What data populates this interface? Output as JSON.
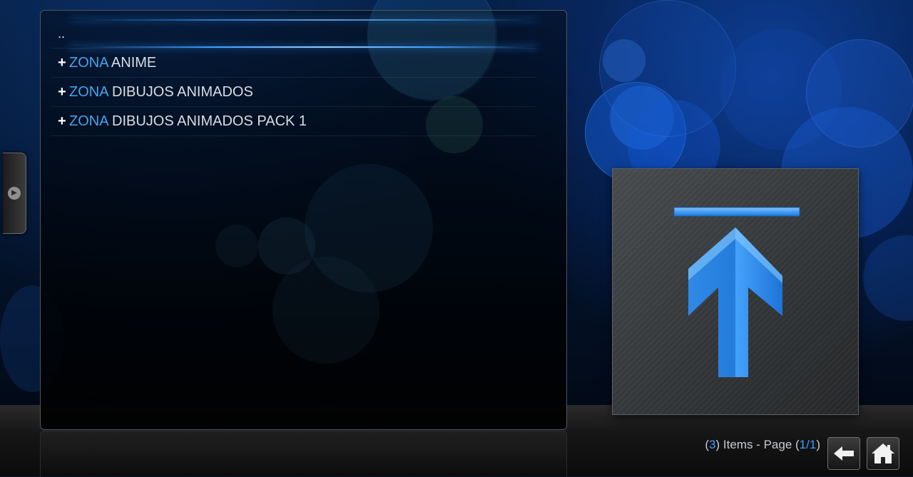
{
  "list": {
    "parent_label": "..",
    "items": [
      {
        "plus": "+",
        "keyword": "ZONA",
        "rest": "ANIME"
      },
      {
        "plus": "+",
        "keyword": "ZONA",
        "rest": "DIBUJOS ANIMADOS"
      },
      {
        "plus": "+",
        "keyword": "ZONA",
        "rest": "DIBUJOS ANIMADOS PACK 1"
      }
    ]
  },
  "preview": {
    "icon": "folder-up-arrow-icon"
  },
  "footer": {
    "open_paren": "(",
    "item_count": "3",
    "items_text": ") Items - Page (",
    "page_current": "1",
    "slash": "/",
    "page_total": "1",
    "close_paren": ")",
    "back_icon": "back-arrow-icon",
    "home_icon": "home-icon"
  },
  "colors": {
    "accent": "#3a9bff",
    "keyword": "#46a4f0",
    "text": "#d8dde3"
  }
}
